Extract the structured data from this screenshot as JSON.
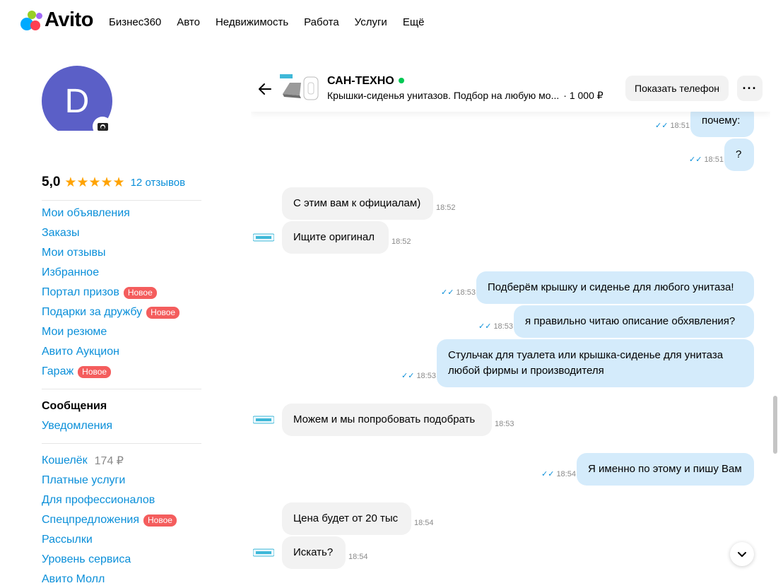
{
  "brand": {
    "name": "Avito",
    "dot_colors": [
      "#00aaff",
      "#ff4053",
      "#97cf26",
      "#a169f7"
    ]
  },
  "nav": [
    "Бизнес360",
    "Авто",
    "Недвижимость",
    "Работа",
    "Услуги",
    "Ещё"
  ],
  "profile": {
    "avatar_letter": "D",
    "rating": "5,0",
    "stars": "★★★★★",
    "reviews": "12 отзывов"
  },
  "menu1": [
    {
      "label": "Мои объявления",
      "badge": ""
    },
    {
      "label": "Заказы",
      "badge": ""
    },
    {
      "label": "Мои отзывы",
      "badge": ""
    },
    {
      "label": "Избранное",
      "badge": ""
    },
    {
      "label": "Портал призов",
      "badge": "Новое"
    },
    {
      "label": "Подарки за дружбу",
      "badge": "Новое"
    },
    {
      "label": "Мои резюме",
      "badge": ""
    },
    {
      "label": "Авито Аукцион",
      "badge": ""
    },
    {
      "label": "Гараж",
      "badge": "Новое"
    }
  ],
  "menu2": [
    {
      "label": "Сообщения"
    },
    {
      "label": "Уведомления"
    }
  ],
  "menu3": [
    {
      "label": "Кошелёк",
      "amount": "174 ₽",
      "badge": ""
    },
    {
      "label": "Платные услуги",
      "badge": ""
    },
    {
      "label": "Для профессионалов",
      "badge": ""
    },
    {
      "label": "Спецпредложения",
      "badge": "Новое"
    },
    {
      "label": "Рассылки",
      "badge": ""
    },
    {
      "label": "Уровень сервиса",
      "badge": ""
    },
    {
      "label": "Авито Молл",
      "badge": ""
    }
  ],
  "chat": {
    "seller": "САН-ТЕХНО",
    "ad_title": "Крышки-сиденья унитазов. Подбор на любую мо...",
    "price": "· 1 000 ₽",
    "show_phone": "Показать телефон",
    "more": "···",
    "messages": [
      {
        "dir": "out",
        "text": "почему:",
        "time": "18:51"
      },
      {
        "dir": "out",
        "text": "?",
        "time": "18:51"
      },
      {
        "dir": "in",
        "text": "С этим вам к официалам)",
        "time": "18:52"
      },
      {
        "dir": "in",
        "text": "Ищите оригинал",
        "time": "18:52"
      },
      {
        "dir": "out",
        "text": "Подберём крышку и сиденье для любого унитаза!",
        "time": "18:53"
      },
      {
        "dir": "out",
        "text": "я правильно читаю описание обхявления?",
        "time": "18:53"
      },
      {
        "dir": "out",
        "text": "Стульчак для туалета или крышка-сиденье для унитаза любой фирмы и производителя",
        "time": "18:53"
      },
      {
        "dir": "in",
        "text": "Можем и мы попробовать подобрать",
        "time": "18:53"
      },
      {
        "dir": "out",
        "text": "Я именно по этому и пишу Вам",
        "time": "18:54"
      },
      {
        "dir": "in",
        "text": "Цена будет от 20 тыс",
        "time": "18:54"
      },
      {
        "dir": "in",
        "text": "Искать?",
        "time": "18:54"
      }
    ]
  }
}
